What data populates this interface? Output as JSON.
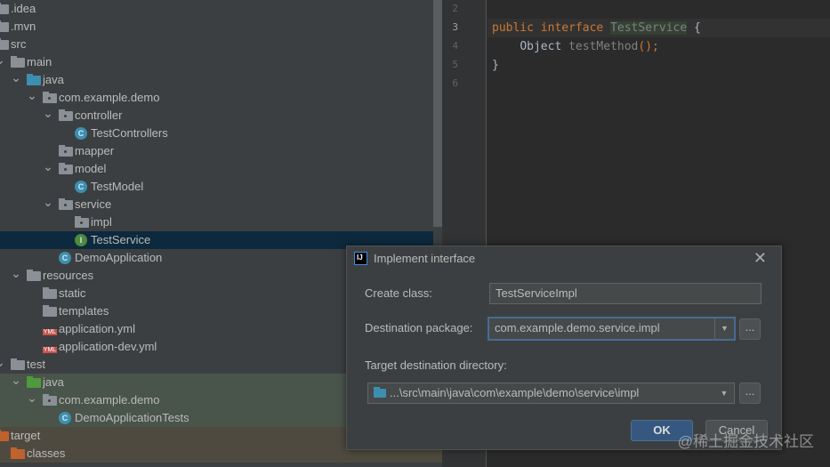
{
  "tree": [
    {
      "label": ".idea",
      "level": 0,
      "icon": "folder-icon"
    },
    {
      "label": ".mvn",
      "level": 0,
      "icon": "folder-icon"
    },
    {
      "label": "src",
      "level": 0,
      "icon": "folder-icon"
    },
    {
      "label": "main",
      "level": 1,
      "icon": "folder-icon",
      "expanded": true
    },
    {
      "label": "java",
      "level": 2,
      "icon": "source-folder-icon",
      "expanded": true
    },
    {
      "label": "com.example.demo",
      "level": 3,
      "icon": "package-icon",
      "expanded": true
    },
    {
      "label": "controller",
      "level": 4,
      "icon": "package-icon",
      "expanded": true
    },
    {
      "label": "TestControllers",
      "level": 5,
      "icon": "class-icon"
    },
    {
      "label": "mapper",
      "level": 4,
      "icon": "package-icon"
    },
    {
      "label": "model",
      "level": 4,
      "icon": "package-icon",
      "expanded": true
    },
    {
      "label": "TestModel",
      "level": 5,
      "icon": "class-icon"
    },
    {
      "label": "service",
      "level": 4,
      "icon": "package-icon",
      "expanded": true
    },
    {
      "label": "impl",
      "level": 5,
      "icon": "package-icon"
    },
    {
      "label": "TestService",
      "level": 5,
      "icon": "interface-icon",
      "selected": true
    },
    {
      "label": "DemoApplication",
      "level": 4,
      "icon": "spring-class-icon"
    },
    {
      "label": "resources",
      "level": 2,
      "icon": "resources-folder-icon",
      "expanded": true
    },
    {
      "label": "static",
      "level": 3,
      "icon": "folder-icon"
    },
    {
      "label": "templates",
      "level": 3,
      "icon": "folder-icon"
    },
    {
      "label": "application.yml",
      "level": 3,
      "icon": "yml-file-icon"
    },
    {
      "label": "application-dev.yml",
      "level": 3,
      "icon": "yml-file-icon"
    },
    {
      "label": "test",
      "level": 1,
      "icon": "folder-icon",
      "expanded": true
    },
    {
      "label": "java",
      "level": 2,
      "icon": "test-folder-icon",
      "expanded": true,
      "bg": "test"
    },
    {
      "label": "com.example.demo",
      "level": 3,
      "icon": "package-icon",
      "expanded": true,
      "bg": "test"
    },
    {
      "label": "DemoApplicationTests",
      "level": 4,
      "icon": "test-class-icon",
      "bg": "test"
    },
    {
      "label": "target",
      "level": 0,
      "icon": "excluded-folder-icon",
      "bg": "target"
    },
    {
      "label": "classes",
      "level": 1,
      "icon": "excluded-folder-icon",
      "bg": "target"
    }
  ],
  "editor": {
    "line_numbers": [
      "2",
      "3",
      "4",
      "5",
      "6"
    ],
    "current_line": "3",
    "code": {
      "public": "public",
      "interface": "interface",
      "name": "TestService",
      "brace_open": "{",
      "type": "Object",
      "method": "testMethod",
      "call": "();",
      "brace_close": "}"
    }
  },
  "dialog": {
    "title": "Implement interface",
    "create_class_label": "Create class:",
    "create_class_value": "TestServiceImpl",
    "dest_package_label": "Destination package:",
    "dest_package_value": "com.example.demo.service.impl",
    "target_dir_label": "Target destination directory:",
    "target_dir_value": "...\\src\\main\\java\\com\\example\\demo\\service\\impl",
    "browse": "...",
    "ok": "OK",
    "cancel": "Cancel"
  },
  "watermark": "@稀土掘金技术社区",
  "colors": {
    "selection": "#0d293e",
    "keyword": "#cc7832",
    "accent": "#365880"
  }
}
